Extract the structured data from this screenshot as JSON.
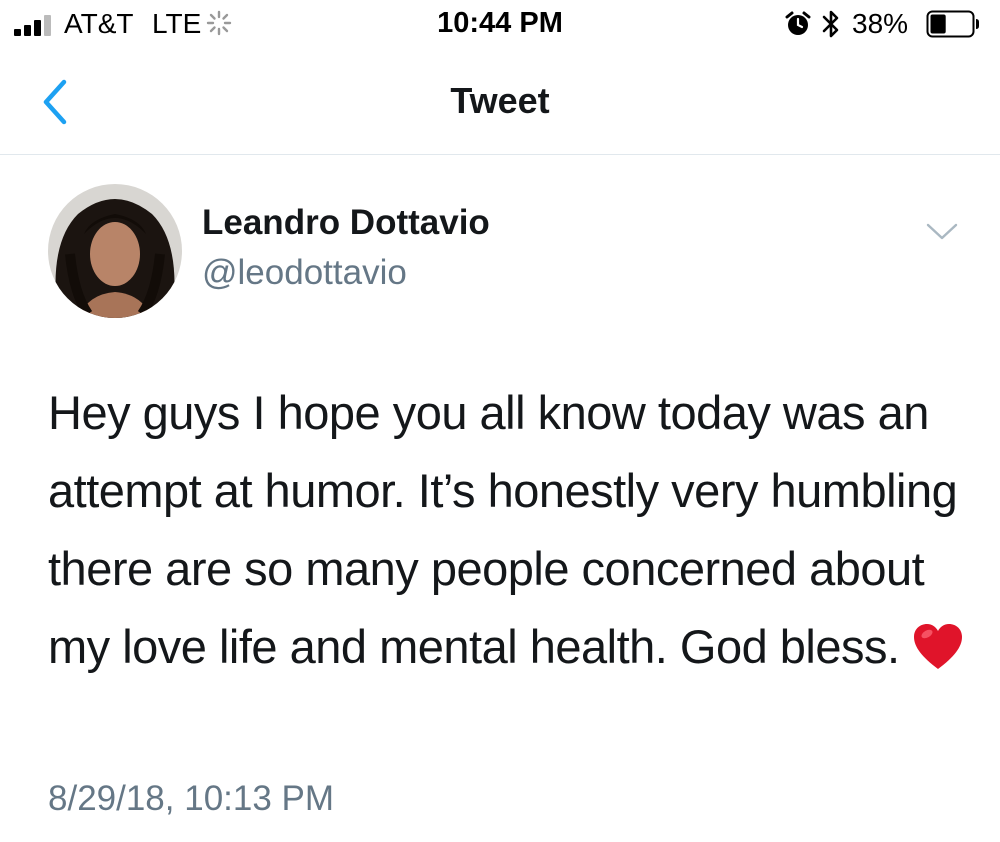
{
  "status_bar": {
    "carrier": "AT&T",
    "network": "LTE",
    "time": "10:44 PM",
    "battery_percent": "38%",
    "battery_level": 0.38,
    "icons": [
      "signal-icon",
      "activity-icon",
      "alarm-icon",
      "bluetooth-icon",
      "battery-icon"
    ]
  },
  "nav": {
    "title": "Tweet",
    "back_icon": "chevron-left-icon"
  },
  "tweet": {
    "author_name": "Leandro Dottavio",
    "author_handle": "@leodottavio",
    "text": "Hey guys I hope you all know today was an attempt at humor. It’s honestly very humbling there are so many people concerned about my love life and mental health. God bless.",
    "emoji": "heart-emoji",
    "timestamp": "8/29/18, 10:13 PM",
    "menu_icon": "chevron-down-icon"
  },
  "colors": {
    "accent": "#1da1f2",
    "text_primary": "#14171a",
    "text_secondary": "#657786",
    "divider": "#e1e8ed",
    "heart": "#e0142a"
  }
}
